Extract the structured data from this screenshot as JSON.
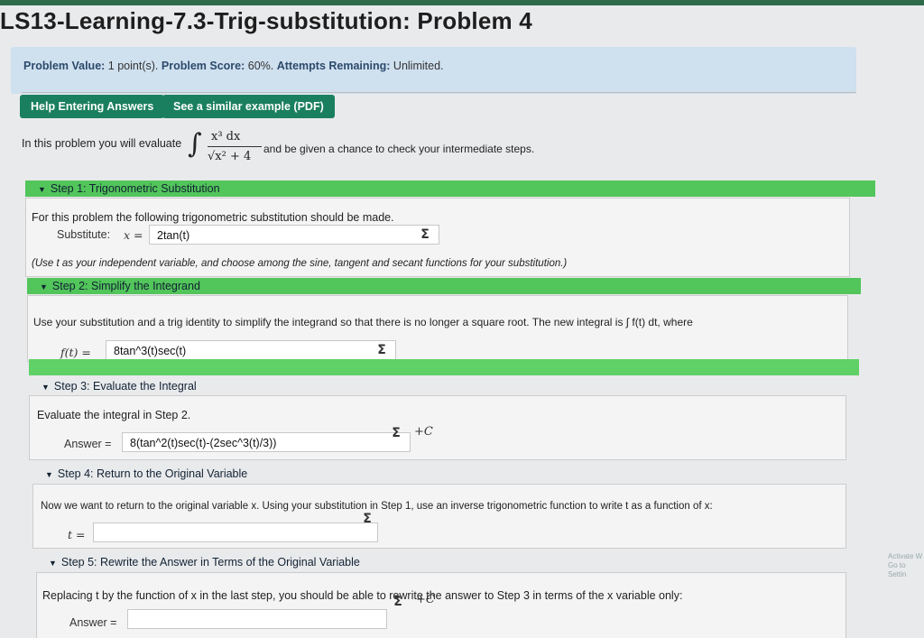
{
  "page": {
    "title": "LS13-Learning-7.3-Trig-substitution: Problem 4"
  },
  "info": {
    "problem_value_label": "Problem Value:",
    "problem_value": "1 point(s).",
    "score_label": "Problem Score:",
    "score": "60%.",
    "attempts_label": "Attempts Remaining:",
    "attempts": "Unlimited."
  },
  "buttons": {
    "help": "Help Entering Answers",
    "example": "See a similar example (PDF)"
  },
  "intro": {
    "prefix": "In this problem you will evaluate",
    "integral_num": "x³ dx",
    "integral_den": "√x² + 4",
    "suffix": "and be given a chance to check your intermediate steps."
  },
  "step1": {
    "header": "Step 1: Trigonometric Substitution",
    "instruction": "For this problem the following trigonometric substitution should be made.",
    "substitute_label": "Substitute:",
    "var_label": "x =",
    "value": "2tan(t)",
    "note": "(Use t as your independent variable, and choose among the sine, tangent and secant functions for your substitution.)"
  },
  "step2": {
    "header": "Step 2: Simplify the Integrand",
    "instruction": "Use your substitution and a trig identity to simplify the integrand so that there is no longer a square root. The new integral is ∫ f(t) dt, where",
    "label": "f(t) =",
    "value": "8tan^3(t)sec(t)"
  },
  "step3": {
    "header": "Step 3: Evaluate the Integral",
    "instruction": "Evaluate the integral in Step 2.",
    "label": "Answer =",
    "value": "8(tan^2(t)sec(t)-(2sec^3(t)/3))",
    "suffix": "+C"
  },
  "step4": {
    "header": "Step 4: Return to the Original Variable",
    "instruction": "Now we want to return to the original variable x. Using your substitution in Step 1, use an inverse trigonometric function to write t as a function of x:",
    "label": "t =",
    "value": ""
  },
  "step5": {
    "header": "Step 5: Rewrite the Answer in Terms of the Original Variable",
    "instruction": "Replacing t by the function of x in the last step, you should be able to rewrite the answer to Step 3 in terms of the x variable only:",
    "label": "Answer =",
    "value": "",
    "suffix": "+C"
  },
  "sigma": "Σ",
  "watermark": {
    "line1": "Activate W",
    "line2": "Go to Settin"
  }
}
